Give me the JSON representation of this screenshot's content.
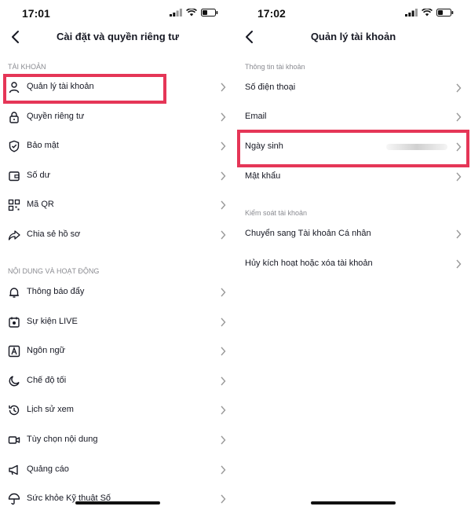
{
  "left": {
    "status_time": "17:01",
    "title": "Cài đặt và quyền riêng tư",
    "section_account": "TÀI KHOẢN",
    "section_content": "NỘI DUNG VÀ HOẠT ĐỘNG",
    "items": [
      {
        "label": "Quản lý tài khoản",
        "icon": "person-icon"
      },
      {
        "label": "Quyền riêng tư",
        "icon": "lock-icon"
      },
      {
        "label": "Bảo mật",
        "icon": "shield-icon"
      },
      {
        "label": "Số dư",
        "icon": "wallet-icon"
      },
      {
        "label": "Mã QR",
        "icon": "qr-code-icon"
      },
      {
        "label": "Chia sẻ hồ sơ",
        "icon": "share-icon"
      },
      {
        "label": "Thông báo đẩy",
        "icon": "bell-icon"
      },
      {
        "label": "Sự kiện LIVE",
        "icon": "live-calendar-icon"
      },
      {
        "label": "Ngôn ngữ",
        "icon": "language-icon"
      },
      {
        "label": "Chế độ tối",
        "icon": "moon-icon"
      },
      {
        "label": "Lịch sử xem",
        "icon": "history-icon"
      },
      {
        "label": "Tùy chọn nội dung",
        "icon": "video-icon"
      },
      {
        "label": "Quảng cáo",
        "icon": "megaphone-icon"
      },
      {
        "label": "Sức khỏe Kỹ thuật Số",
        "icon": "umbrella-icon"
      }
    ]
  },
  "right": {
    "status_time": "17:02",
    "title": "Quản lý tài khoản",
    "section_info": "Thông tin tài khoản",
    "section_control": "Kiểm soát tài khoản",
    "items": [
      {
        "label": "Số điện thoại"
      },
      {
        "label": "Email"
      },
      {
        "label": "Ngày sinh"
      },
      {
        "label": "Mật khẩu"
      },
      {
        "label": "Chuyển sang Tài khoản Cá nhân"
      },
      {
        "label": "Hủy kích hoạt hoặc xóa tài khoản"
      }
    ]
  },
  "colors": {
    "highlight": "#e53657",
    "text": "#161823",
    "section": "#8a8b91"
  }
}
